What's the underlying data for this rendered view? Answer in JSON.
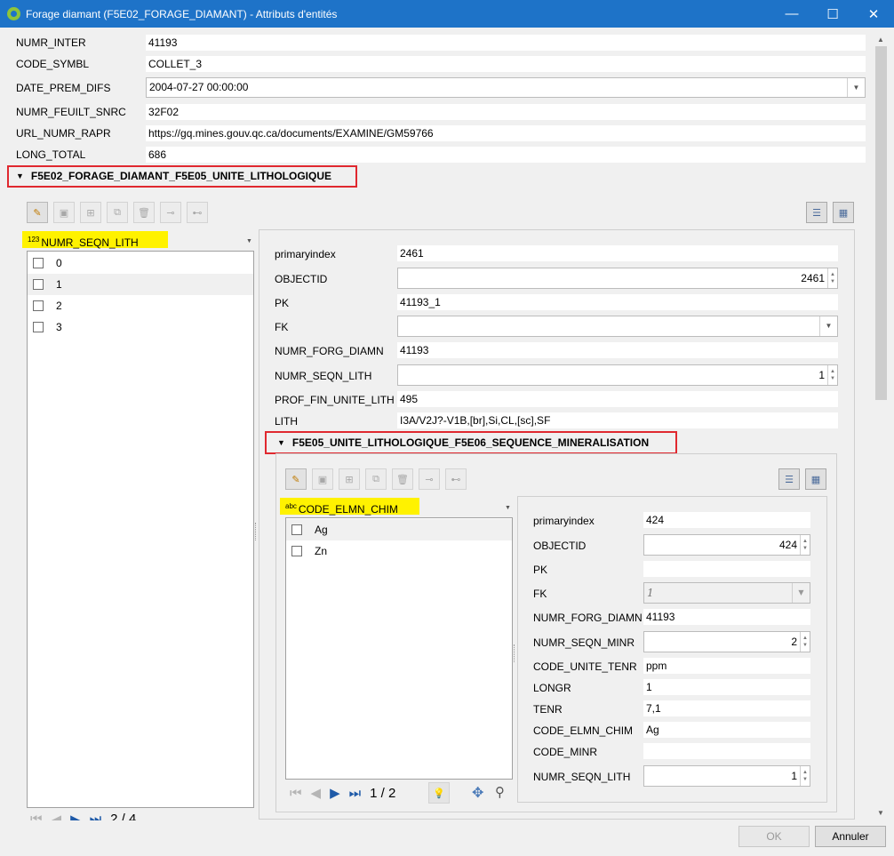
{
  "window": {
    "title": "Forage diamant (F5E02_FORAGE_DIAMANT) - Attributs d'entités",
    "minimize": "—",
    "maximize": "☐",
    "close": "✕"
  },
  "top_fields": [
    {
      "label": "NUMR_INTER",
      "value": "41193"
    },
    {
      "label": "CODE_SYMBL",
      "value": "COLLET_3"
    },
    {
      "label": "DATE_PREM_DIFS",
      "value": "2004-07-27 00:00:00"
    },
    {
      "label": "NUMR_FEUILT_SNRC",
      "value": "32F02"
    },
    {
      "label": "URL_NUMR_RAPR",
      "value": "https://gq.mines.gouv.qc.ca/documents/EXAMINE/GM59766"
    },
    {
      "label": "LONG_TOTAL",
      "value": "686"
    }
  ],
  "relation1": {
    "title": "F5E02_FORAGE_DIAMANT_F5E05_UNITE_LITHOLOGIQUE",
    "list_header": {
      "type_badge": "123",
      "field": "NUMR_SEQN_LITH"
    },
    "list_items": [
      "0",
      "1",
      "2",
      "3"
    ],
    "nav_count": "2 / 4",
    "form": [
      {
        "label": "primaryindex",
        "value": "2461"
      },
      {
        "label": "OBJECTID",
        "value": "2461"
      },
      {
        "label": "PK",
        "value": "41193_1"
      },
      {
        "label": "FK",
        "value": ""
      },
      {
        "label": "NUMR_FORG_DIAMN",
        "value": "41193"
      },
      {
        "label": "NUMR_SEQN_LITH",
        "value": "1"
      },
      {
        "label": "PROF_FIN_UNITE_LITH",
        "value": "495"
      },
      {
        "label": "LITH",
        "value": "I3A/V2J?-V1B,[br],Si,CL,[sc],SF"
      }
    ]
  },
  "relation2": {
    "title": "F5E05_UNITE_LITHOLOGIQUE_F5E06_SEQUENCE_MINERALISATION",
    "list_header": {
      "type_badge": "abc",
      "field": "CODE_ELMN_CHIM"
    },
    "list_items": [
      "Ag",
      "Zn"
    ],
    "nav_count": "1 / 2",
    "form": [
      {
        "label": "primaryindex",
        "value": "424"
      },
      {
        "label": "OBJECTID",
        "value": "424"
      },
      {
        "label": "PK",
        "value": ""
      },
      {
        "label": "FK",
        "value": "1"
      },
      {
        "label": "NUMR_FORG_DIAMN",
        "value": "41193"
      },
      {
        "label": "NUMR_SEQN_MINR",
        "value": "2"
      },
      {
        "label": "CODE_UNITE_TENR",
        "value": "ppm"
      },
      {
        "label": "LONGR",
        "value": "1"
      },
      {
        "label": "TENR",
        "value": "7,1"
      },
      {
        "label": "CODE_ELMN_CHIM",
        "value": "Ag"
      },
      {
        "label": "CODE_MINR",
        "value": ""
      },
      {
        "label": "NUMR_SEQN_LITH",
        "value": "1"
      }
    ]
  },
  "buttons": {
    "ok": "OK",
    "cancel": "Annuler"
  },
  "colors": {
    "titlebar": "#1e73c8",
    "highlight": "#fff200",
    "annotation": "#e0282f"
  }
}
